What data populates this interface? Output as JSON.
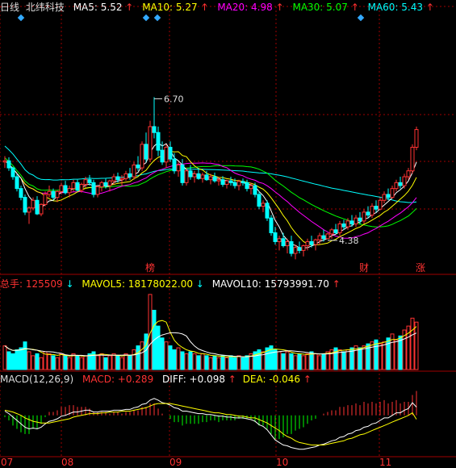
{
  "header": {
    "period": "日线",
    "stock": "北纬科技",
    "ma": [
      {
        "label": "MA5: 5.52",
        "color": "#ffffff"
      },
      {
        "label": "MA10: 5.27",
        "color": "#ffff00"
      },
      {
        "label": "MA20: 4.98",
        "color": "#ff00ff"
      },
      {
        "label": "MA30: 5.07",
        "color": "#00ff00"
      },
      {
        "label": "MA60: 5.43",
        "color": "#00ffff"
      }
    ],
    "up_arrow": "↑",
    "down_arrow": "↓"
  },
  "volume_bar": {
    "total_label": "总手: 125509",
    "mavol5": "MAVOL5: 18178022.00",
    "mavol10": "MAVOL10: 15793991.70"
  },
  "macd_bar": {
    "title": "MACD(12,26,9)",
    "macd": "MACD: +0.289",
    "diff": "DIFF: +0.098",
    "dea": "DEA: -0.046"
  },
  "colors": {
    "up": "#ff3232",
    "down": "#00ffff",
    "grid": "#a00000",
    "ma5": "#ffffff",
    "ma10": "#ffff00",
    "ma20": "#ff00ff",
    "ma30": "#00ff00",
    "ma60": "#00ffff",
    "axis_text": "#ff3232",
    "marker_text": "#ff3232"
  },
  "chart_data": {
    "type": "candlestick",
    "title": "北纬科技 日线",
    "annotations": {
      "high": {
        "label": "6.70",
        "value": 6.7,
        "index": 37
      },
      "low": {
        "label": "4.38",
        "value": 4.38,
        "index": 80
      },
      "markers": [
        {
          "text": "榜",
          "index": 36
        },
        {
          "text": "财",
          "index": 89
        },
        {
          "text": "涨",
          "index": 103
        }
      ],
      "diamonds": [
        4,
        36,
        39,
        89
      ]
    },
    "x_axis_labels": [
      {
        "text": "07",
        "index": 0
      },
      {
        "text": "08",
        "index": 17
      },
      {
        "text": "09",
        "index": 44
      },
      {
        "text": "10",
        "index": 71
      },
      {
        "text": "11",
        "index": 97
      }
    ],
    "ohlc": [
      [
        5.6,
        5.7,
        5.5,
        5.62
      ],
      [
        5.62,
        5.68,
        5.45,
        5.5
      ],
      [
        5.5,
        5.52,
        5.3,
        5.35
      ],
      [
        5.35,
        5.4,
        5.1,
        5.15
      ],
      [
        5.15,
        5.2,
        4.95,
        5.0
      ],
      [
        5.0,
        5.05,
        4.7,
        4.75
      ],
      [
        4.75,
        4.85,
        4.55,
        4.82
      ],
      [
        4.82,
        5.0,
        4.78,
        4.95
      ],
      [
        4.95,
        5.02,
        4.7,
        4.72
      ],
      [
        4.72,
        4.9,
        4.68,
        4.88
      ],
      [
        4.88,
        5.1,
        4.85,
        5.05
      ],
      [
        5.05,
        5.2,
        5.0,
        5.1
      ],
      [
        5.1,
        5.15,
        4.95,
        5.0
      ],
      [
        5.0,
        5.12,
        4.92,
        5.1
      ],
      [
        5.1,
        5.25,
        5.05,
        5.2
      ],
      [
        5.2,
        5.28,
        5.05,
        5.08
      ],
      [
        5.08,
        5.2,
        5.0,
        5.15
      ],
      [
        5.15,
        5.3,
        5.1,
        5.25
      ],
      [
        5.25,
        5.3,
        5.1,
        5.12
      ],
      [
        5.12,
        5.25,
        5.08,
        5.22
      ],
      [
        5.22,
        5.35,
        5.15,
        5.3
      ],
      [
        5.3,
        5.38,
        5.2,
        5.25
      ],
      [
        5.25,
        5.3,
        5.0,
        5.05
      ],
      [
        5.05,
        5.2,
        5.0,
        5.18
      ],
      [
        5.18,
        5.28,
        5.1,
        5.25
      ],
      [
        5.25,
        5.32,
        5.15,
        5.2
      ],
      [
        5.2,
        5.3,
        5.1,
        5.28
      ],
      [
        5.28,
        5.4,
        5.22,
        5.35
      ],
      [
        5.35,
        5.42,
        5.25,
        5.3
      ],
      [
        5.3,
        5.38,
        5.2,
        5.32
      ],
      [
        5.32,
        5.45,
        5.28,
        5.4
      ],
      [
        5.4,
        5.5,
        5.3,
        5.35
      ],
      [
        5.35,
        5.6,
        5.3,
        5.55
      ],
      [
        5.55,
        5.7,
        5.45,
        5.5
      ],
      [
        5.5,
        5.95,
        5.45,
        5.9
      ],
      [
        5.9,
        6.1,
        5.6,
        5.65
      ],
      [
        5.65,
        6.3,
        5.6,
        6.2
      ],
      [
        6.2,
        6.7,
        6.0,
        6.1
      ],
      [
        6.1,
        6.2,
        5.7,
        5.8
      ],
      [
        5.8,
        5.95,
        5.55,
        5.6
      ],
      [
        5.6,
        5.9,
        5.5,
        5.85
      ],
      [
        5.85,
        5.95,
        5.6,
        5.65
      ],
      [
        5.65,
        5.75,
        5.4,
        5.45
      ],
      [
        5.45,
        5.6,
        5.35,
        5.55
      ],
      [
        5.55,
        5.65,
        5.2,
        5.25
      ],
      [
        5.25,
        5.5,
        5.2,
        5.45
      ],
      [
        5.45,
        5.55,
        5.3,
        5.35
      ],
      [
        5.35,
        5.45,
        5.25,
        5.4
      ],
      [
        5.4,
        5.5,
        5.3,
        5.32
      ],
      [
        5.32,
        5.42,
        5.25,
        5.38
      ],
      [
        5.38,
        5.45,
        5.28,
        5.3
      ],
      [
        5.3,
        5.4,
        5.22,
        5.35
      ],
      [
        5.35,
        5.42,
        5.25,
        5.28
      ],
      [
        5.28,
        5.35,
        5.2,
        5.3
      ],
      [
        5.3,
        5.36,
        5.18,
        5.22
      ],
      [
        5.22,
        5.3,
        5.15,
        5.28
      ],
      [
        5.28,
        5.35,
        5.2,
        5.25
      ],
      [
        5.25,
        5.32,
        5.15,
        5.2
      ],
      [
        5.2,
        5.3,
        5.12,
        5.27
      ],
      [
        5.27,
        5.32,
        5.2,
        5.25
      ],
      [
        5.25,
        5.3,
        5.1,
        5.15
      ],
      [
        5.15,
        5.25,
        5.05,
        5.2
      ],
      [
        5.2,
        5.25,
        5.0,
        5.05
      ],
      [
        5.05,
        5.1,
        4.8,
        4.85
      ],
      [
        4.85,
        4.95,
        4.75,
        4.9
      ],
      [
        4.9,
        4.95,
        4.6,
        4.65
      ],
      [
        4.65,
        4.7,
        4.35,
        4.4
      ],
      [
        4.4,
        4.5,
        4.2,
        4.25
      ],
      [
        4.25,
        4.35,
        4.1,
        4.3
      ],
      [
        4.3,
        4.4,
        4.15,
        4.18
      ],
      [
        4.18,
        4.3,
        4.05,
        4.25
      ],
      [
        4.25,
        4.35,
        4.0,
        4.05
      ],
      [
        4.05,
        4.2,
        3.95,
        4.15
      ],
      [
        4.15,
        4.25,
        4.05,
        4.1
      ],
      [
        4.1,
        4.2,
        4.0,
        4.18
      ],
      [
        4.18,
        4.3,
        4.1,
        4.25
      ],
      [
        4.25,
        4.35,
        4.15,
        4.2
      ],
      [
        4.2,
        4.3,
        4.1,
        4.28
      ],
      [
        4.28,
        4.4,
        4.2,
        4.35
      ],
      [
        4.35,
        4.45,
        4.25,
        4.3
      ],
      [
        4.3,
        4.4,
        4.38,
        4.38
      ],
      [
        4.38,
        4.48,
        4.3,
        4.45
      ],
      [
        4.45,
        4.55,
        4.38,
        4.4
      ],
      [
        4.4,
        4.6,
        4.35,
        4.55
      ],
      [
        4.55,
        4.62,
        4.45,
        4.5
      ],
      [
        4.5,
        4.65,
        4.45,
        4.6
      ],
      [
        4.6,
        4.7,
        4.5,
        4.55
      ],
      [
        4.55,
        4.7,
        4.5,
        4.65
      ],
      [
        4.65,
        4.75,
        4.55,
        4.6
      ],
      [
        4.6,
        4.8,
        4.55,
        4.75
      ],
      [
        4.75,
        4.85,
        4.65,
        4.7
      ],
      [
        4.7,
        4.9,
        4.65,
        4.85
      ],
      [
        4.85,
        4.95,
        4.75,
        4.8
      ],
      [
        4.8,
        5.0,
        4.78,
        4.95
      ],
      [
        4.95,
        5.1,
        4.9,
        5.05
      ],
      [
        5.05,
        5.15,
        4.95,
        5.0
      ],
      [
        5.0,
        5.2,
        4.98,
        5.15
      ],
      [
        5.15,
        5.3,
        5.1,
        5.25
      ],
      [
        5.25,
        5.35,
        5.15,
        5.2
      ],
      [
        5.2,
        5.4,
        5.15,
        5.35
      ],
      [
        5.35,
        5.5,
        5.3,
        5.45
      ],
      [
        5.45,
        5.9,
        5.4,
        5.85
      ],
      [
        5.85,
        6.2,
        5.8,
        6.15
      ]
    ],
    "volume": [
      12,
      9,
      8,
      10,
      11,
      14,
      9,
      7,
      8,
      6,
      9,
      8,
      7,
      6,
      8,
      7,
      6,
      8,
      7,
      6,
      7,
      8,
      9,
      7,
      8,
      6,
      7,
      8,
      7,
      6,
      8,
      7,
      10,
      12,
      14,
      18,
      38,
      30,
      22,
      16,
      14,
      12,
      10,
      11,
      9,
      8,
      9,
      8,
      7,
      8,
      7,
      6,
      7,
      6,
      7,
      6,
      7,
      6,
      7,
      6,
      7,
      8,
      9,
      10,
      9,
      11,
      12,
      10,
      9,
      8,
      9,
      8,
      7,
      8,
      7,
      8,
      9,
      8,
      7,
      8,
      9,
      10,
      11,
      10,
      9,
      10,
      11,
      12,
      11,
      12,
      13,
      14,
      15,
      13,
      14,
      16,
      18,
      15,
      17,
      20,
      22,
      26,
      24
    ],
    "volume_scale_max": 40,
    "macd": {
      "diff": [
        0.05,
        0.02,
        -0.02,
        -0.06,
        -0.1,
        -0.14,
        -0.16,
        -0.15,
        -0.16,
        -0.14,
        -0.1,
        -0.07,
        -0.06,
        -0.04,
        -0.01,
        0.0,
        0.02,
        0.04,
        0.04,
        0.05,
        0.06,
        0.06,
        0.04,
        0.04,
        0.05,
        0.05,
        0.05,
        0.06,
        0.06,
        0.06,
        0.07,
        0.07,
        0.09,
        0.1,
        0.13,
        0.14,
        0.18,
        0.2,
        0.18,
        0.15,
        0.14,
        0.12,
        0.09,
        0.08,
        0.05,
        0.05,
        0.04,
        0.03,
        0.02,
        0.02,
        0.01,
        0.01,
        0.0,
        -0.01,
        -0.01,
        -0.02,
        -0.02,
        -0.03,
        -0.03,
        -0.03,
        -0.04,
        -0.05,
        -0.07,
        -0.11,
        -0.13,
        -0.17,
        -0.23,
        -0.29,
        -0.32,
        -0.35,
        -0.36,
        -0.38,
        -0.39,
        -0.4,
        -0.4,
        -0.39,
        -0.38,
        -0.37,
        -0.35,
        -0.34,
        -0.32,
        -0.3,
        -0.29,
        -0.26,
        -0.25,
        -0.22,
        -0.21,
        -0.18,
        -0.17,
        -0.14,
        -0.13,
        -0.1,
        -0.09,
        -0.06,
        -0.03,
        -0.03,
        0.0,
        0.03,
        0.03,
        0.06,
        0.08,
        0.15,
        0.098
      ],
      "dea": [
        0.06,
        0.05,
        0.04,
        0.02,
        0.0,
        -0.03,
        -0.05,
        -0.07,
        -0.08,
        -0.09,
        -0.09,
        -0.09,
        -0.08,
        -0.07,
        -0.06,
        -0.05,
        -0.04,
        -0.02,
        -0.01,
        0.0,
        0.01,
        0.02,
        0.02,
        0.02,
        0.03,
        0.03,
        0.04,
        0.04,
        0.04,
        0.05,
        0.05,
        0.05,
        0.06,
        0.07,
        0.08,
        0.09,
        0.11,
        0.13,
        0.14,
        0.14,
        0.14,
        0.14,
        0.13,
        0.12,
        0.11,
        0.1,
        0.09,
        0.08,
        0.07,
        0.06,
        0.05,
        0.04,
        0.03,
        0.03,
        0.02,
        0.01,
        0.01,
        0.0,
        -0.01,
        -0.01,
        -0.02,
        -0.03,
        -0.03,
        -0.05,
        -0.07,
        -0.09,
        -0.12,
        -0.15,
        -0.18,
        -0.22,
        -0.25,
        -0.27,
        -0.3,
        -0.32,
        -0.33,
        -0.34,
        -0.35,
        -0.35,
        -0.35,
        -0.35,
        -0.34,
        -0.33,
        -0.32,
        -0.31,
        -0.3,
        -0.28,
        -0.27,
        -0.25,
        -0.23,
        -0.22,
        -0.2,
        -0.18,
        -0.16,
        -0.14,
        -0.12,
        -0.1,
        -0.08,
        -0.06,
        -0.04,
        -0.02,
        0.0,
        0.03,
        -0.046
      ]
    },
    "price_range": [
      3.9,
      7.8
    ],
    "macd_range": [
      -0.45,
      0.35
    ]
  }
}
